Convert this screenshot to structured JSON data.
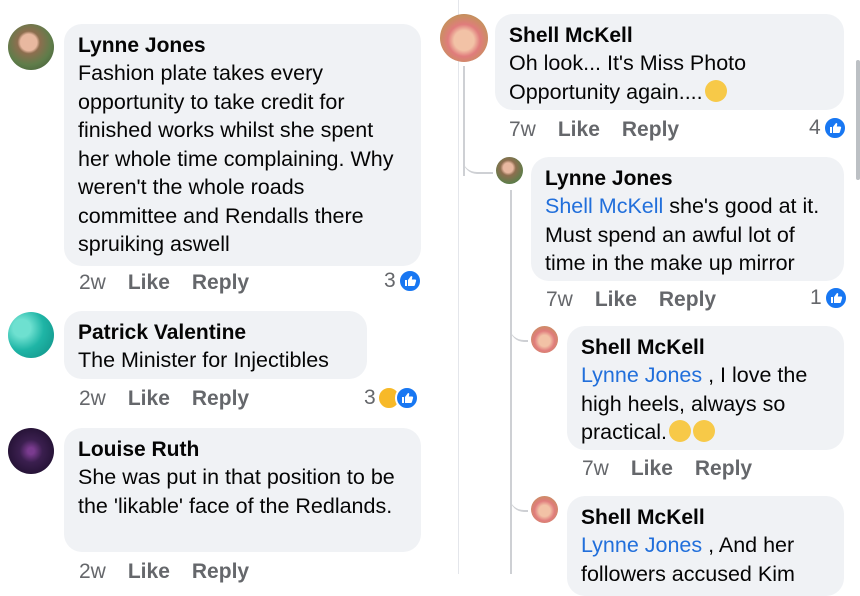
{
  "left_comments": [
    {
      "author": "Lynne Jones",
      "text": "Fashion plate takes every opportunity to take credit for finished works whilst she spent her whole time complaining. Why weren't the whole roads committee and Rendalls there spruiking aswell",
      "time": "2w",
      "like": "Like",
      "reply": "Reply",
      "reactions": "3"
    },
    {
      "author": "Patrick Valentine",
      "text": "The Minister for Injectibles",
      "time": "2w",
      "like": "Like",
      "reply": "Reply",
      "reactions": "3"
    },
    {
      "author": "Louise Ruth",
      "text": "She was put in that position to be the 'likable' face of the Redlands.",
      "time": "2w",
      "like": "Like",
      "reply": "Reply"
    }
  ],
  "right_thread": [
    {
      "author": "Shell McKell",
      "text": "Oh look... It's Miss Photo Opportunity again....",
      "time": "7w",
      "like": "Like",
      "reply": "Reply",
      "reactions": "4"
    },
    {
      "author": "Lynne Jones",
      "mention": "Shell McKell",
      "text": " she's good at it. Must spend an awful lot of time in the make up mirror",
      "time": "7w",
      "like": "Like",
      "reply": "Reply",
      "reactions": "1"
    },
    {
      "author": "Shell McKell",
      "mention": "Lynne Jones",
      "text": " , I love the high heels, always so practical.",
      "time": "7w",
      "like": "Like",
      "reply": "Reply"
    },
    {
      "author": "Shell McKell",
      "mention": "Lynne Jones",
      "text": " , And her followers accused Kim"
    }
  ],
  "colors": {
    "bubble": "#f0f2f5",
    "mention": "#216fdb",
    "like_blue": "#1877f2",
    "meta": "#65676b"
  }
}
